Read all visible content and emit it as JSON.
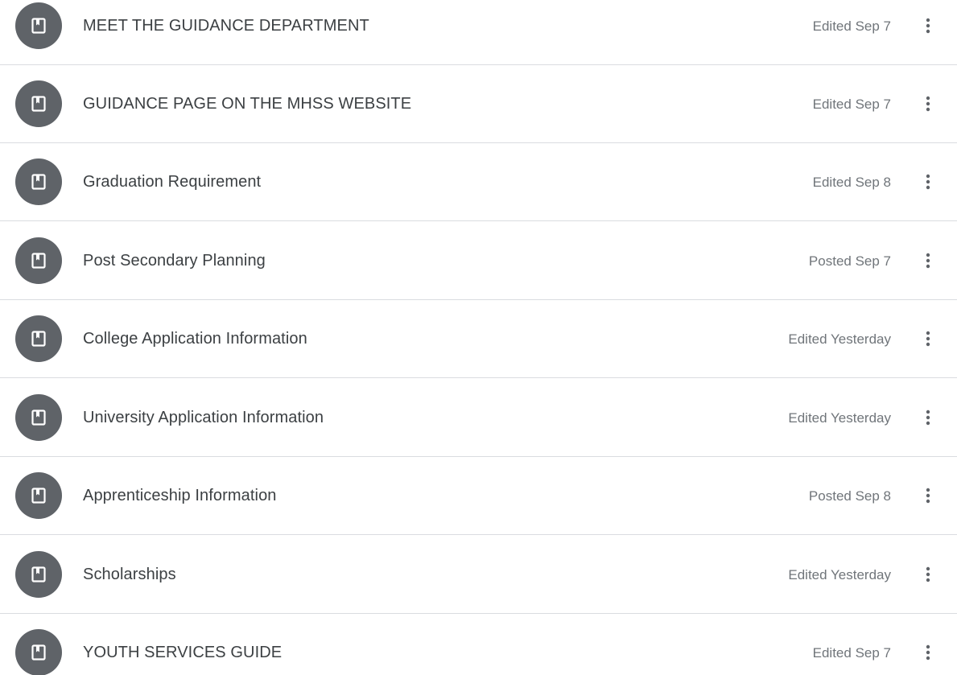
{
  "colors": {
    "avatar_bg": "#5f6368",
    "icon_fg": "#ffffff",
    "title_text": "#3c4043",
    "status_text": "#70757a",
    "divider": "#dadce0",
    "more_icon": "#5f6368"
  },
  "materials": [
    {
      "title": "MEET THE GUIDANCE DEPARTMENT",
      "status": "Edited Sep 7",
      "icon": "bookmark-book-icon",
      "menu_icon": "more-vert-icon"
    },
    {
      "title": "GUIDANCE PAGE ON THE MHSS WEBSITE",
      "status": "Edited Sep 7",
      "icon": "bookmark-book-icon",
      "menu_icon": "more-vert-icon"
    },
    {
      "title": "Graduation Requirement",
      "status": "Edited Sep 8",
      "icon": "bookmark-book-icon",
      "menu_icon": "more-vert-icon"
    },
    {
      "title": "Post Secondary Planning",
      "status": "Posted Sep 7",
      "icon": "bookmark-book-icon",
      "menu_icon": "more-vert-icon"
    },
    {
      "title": "College Application Information",
      "status": "Edited Yesterday",
      "icon": "bookmark-book-icon",
      "menu_icon": "more-vert-icon"
    },
    {
      "title": "University Application Information",
      "status": "Edited Yesterday",
      "icon": "bookmark-book-icon",
      "menu_icon": "more-vert-icon"
    },
    {
      "title": "Apprenticeship Information",
      "status": "Posted Sep 8",
      "icon": "bookmark-book-icon",
      "menu_icon": "more-vert-icon"
    },
    {
      "title": "Scholarships",
      "status": "Edited Yesterday",
      "icon": "bookmark-book-icon",
      "menu_icon": "more-vert-icon"
    },
    {
      "title": "YOUTH SERVICES GUIDE",
      "status": "Edited Sep 7",
      "icon": "bookmark-book-icon",
      "menu_icon": "more-vert-icon"
    }
  ]
}
